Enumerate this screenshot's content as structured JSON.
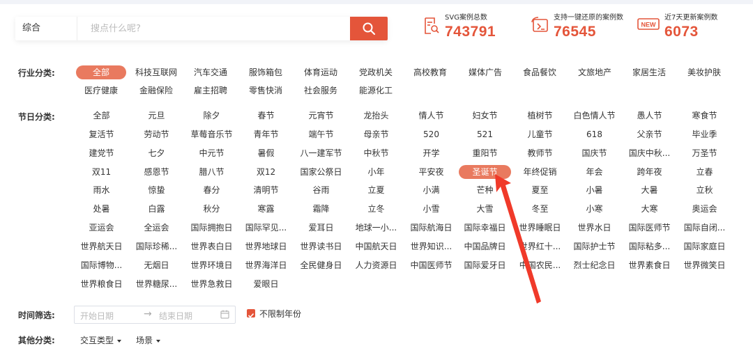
{
  "search": {
    "category": "综合",
    "placeholder": "搜点什么呢?"
  },
  "stats": [
    {
      "label": "SVG案例总数",
      "value": "743791",
      "icon": "document-search-icon"
    },
    {
      "label": "支持一键还原的案例数",
      "value": "76545",
      "icon": "restore-case-icon"
    },
    {
      "label": "近7天更新案例数",
      "value": "6073",
      "icon": "new-badge-icon",
      "badge": "NEW"
    }
  ],
  "industry": {
    "label": "行业分类:",
    "items": [
      "全部",
      "科技互联网",
      "汽车交通",
      "服饰箱包",
      "体育运动",
      "党政机关",
      "高校教育",
      "媒体广告",
      "食品餐饮",
      "文旅地产",
      "家居生活",
      "美妆护肤",
      "医疗健康",
      "金融保险",
      "雇主招聘",
      "零售快消",
      "社会服务",
      "能源化工"
    ],
    "active": "全部"
  },
  "festival": {
    "label": "节日分类:",
    "items": [
      "全部",
      "元旦",
      "除夕",
      "春节",
      "元宵节",
      "龙抬头",
      "情人节",
      "妇女节",
      "植树节",
      "白色情人节",
      "愚人节",
      "寒食节",
      "复活节",
      "劳动节",
      "草莓音乐节",
      "青年节",
      "端午节",
      "母亲节",
      "520",
      "521",
      "儿童节",
      "618",
      "父亲节",
      "毕业季",
      "建党节",
      "七夕",
      "中元节",
      "暑假",
      "八一建军节",
      "中秋节",
      "开学",
      "重阳节",
      "教师节",
      "国庆节",
      "国庆中秋...",
      "万圣节",
      "双11",
      "感恩节",
      "腊八节",
      "双12",
      "国家公祭日",
      "小年",
      "平安夜",
      "圣诞节",
      "年终促销",
      "年会",
      "跨年夜",
      "立春",
      "雨水",
      "惊蛰",
      "春分",
      "清明节",
      "谷雨",
      "立夏",
      "小满",
      "芒种",
      "夏至",
      "小暑",
      "大暑",
      "立秋",
      "处暑",
      "白露",
      "秋分",
      "寒露",
      "霜降",
      "立冬",
      "小雪",
      "大雪",
      "冬至",
      "小寒",
      "大寒",
      "奥运会",
      "亚运会",
      "全运会",
      "国际拥抱日",
      "国际罕见...",
      "爱耳日",
      "地球一小...",
      "国际航海日",
      "国际幸福日",
      "世界睡眠日",
      "世界水日",
      "国际医师节",
      "国际自闭...",
      "世界航天日",
      "国际珍稀...",
      "世界表白日",
      "世界地球日",
      "世界读书日",
      "中国航天日",
      "世界知识...",
      "中国品牌日",
      "世界红十...",
      "国际护士节",
      "国际粘多...",
      "国际家庭日",
      "国际博物...",
      "无烟日",
      "世界环境日",
      "世界海洋日",
      "全民健身日",
      "人力资源日",
      "中国医师节",
      "国际爱牙日",
      "中国农民...",
      "烈士纪念日",
      "世界素食日",
      "世界微笑日",
      "世界粮食日",
      "世界糖尿...",
      "世界急救日",
      "爱眼日"
    ],
    "active": "圣诞节"
  },
  "time": {
    "label": "时间筛选:",
    "start_placeholder": "开始日期",
    "end_placeholder": "结束日期",
    "separator": "→",
    "checkbox_label": "不限制年份",
    "checkbox_checked": true
  },
  "other": {
    "label": "其他分类:",
    "dropdowns": [
      "交互类型",
      "场景"
    ]
  },
  "colors": {
    "accent": "#e4553a",
    "active_tag": "#e97a5f",
    "annotation_arrow": "#f03a2a"
  }
}
